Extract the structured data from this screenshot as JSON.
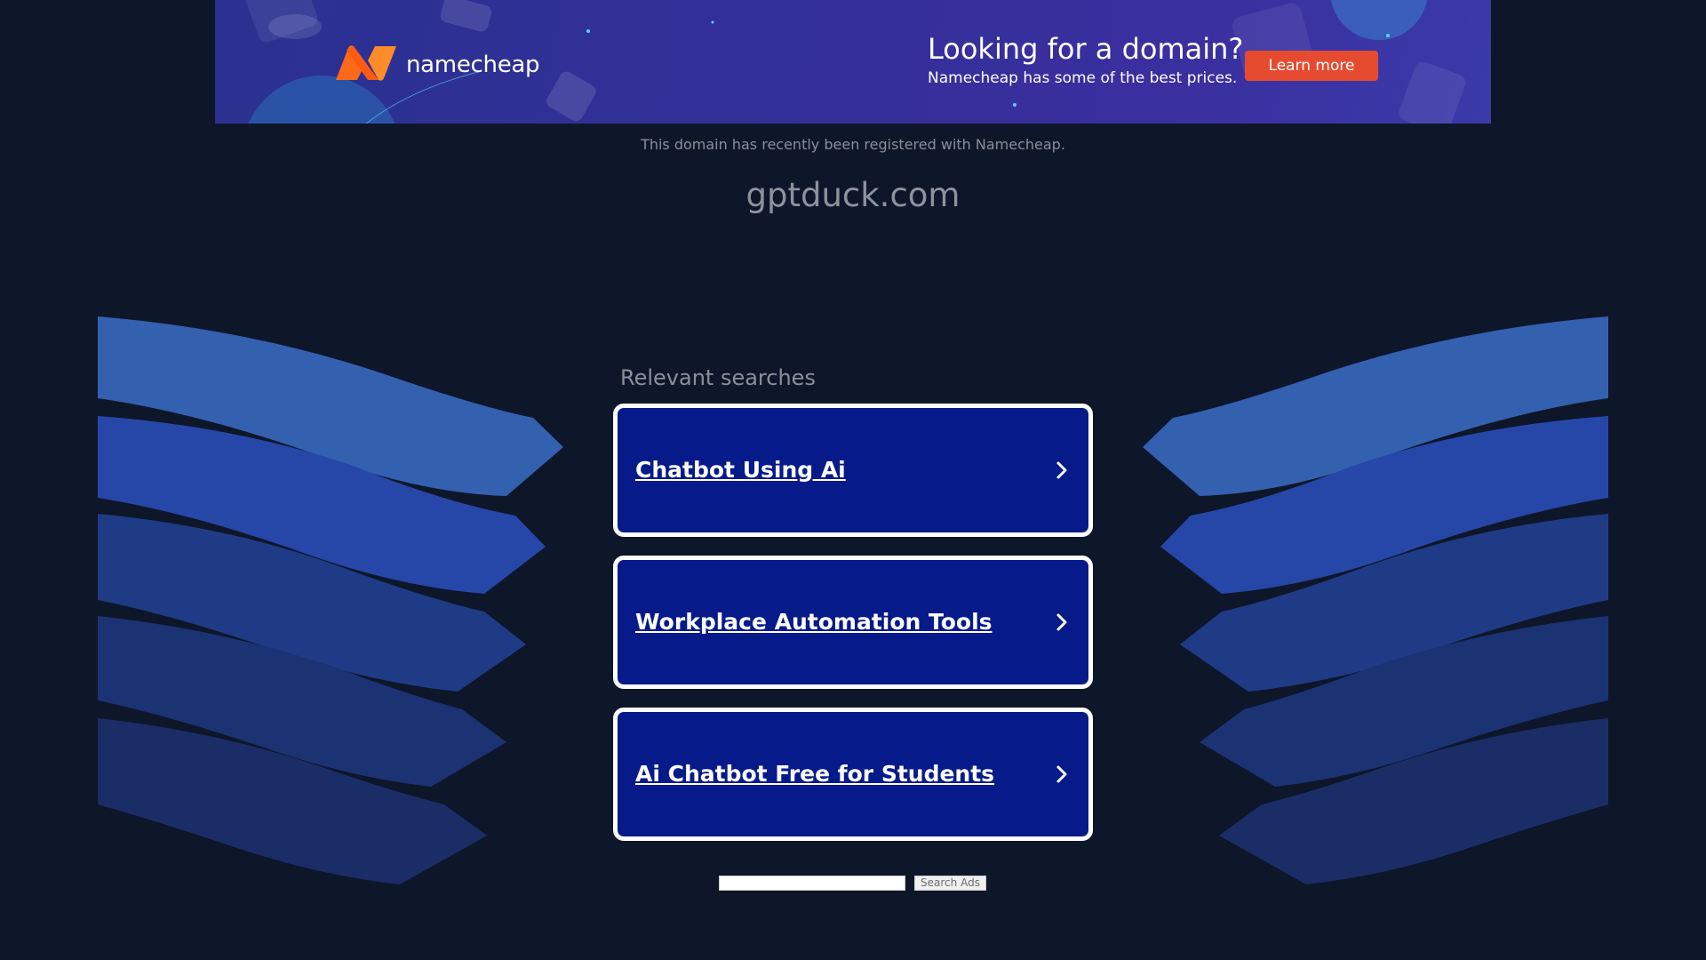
{
  "banner": {
    "brand_name": "namecheap",
    "headline": "Looking for a domain?",
    "subtext": "Namecheap has some of the best prices.",
    "cta_label": "Learn more",
    "colors": {
      "background": "#332f99",
      "cta": "#e74b2f",
      "logo_orange": "#ff6a1a"
    }
  },
  "header": {
    "registered_note": "This domain has recently been registered with Namecheap.",
    "domain": "gptduck.com"
  },
  "related": {
    "title": "Relevant searches",
    "items": [
      {
        "label": "Chatbot Using Ai",
        "icon": "chevron-right-icon"
      },
      {
        "label": "Workplace Automation Tools",
        "icon": "chevron-right-icon"
      },
      {
        "label": "Ai Chatbot Free for Students",
        "icon": "chevron-right-icon"
      }
    ]
  },
  "search": {
    "input_value": "",
    "button_label": "Search Ads"
  },
  "colors": {
    "page_background": "#0e1629",
    "result_background": "#061a8a",
    "result_border": "#ffffff",
    "ribbon_shades": [
      "#3460b0",
      "#2647a8",
      "#1f3b85",
      "#1b3273",
      "#1a2d66"
    ]
  }
}
